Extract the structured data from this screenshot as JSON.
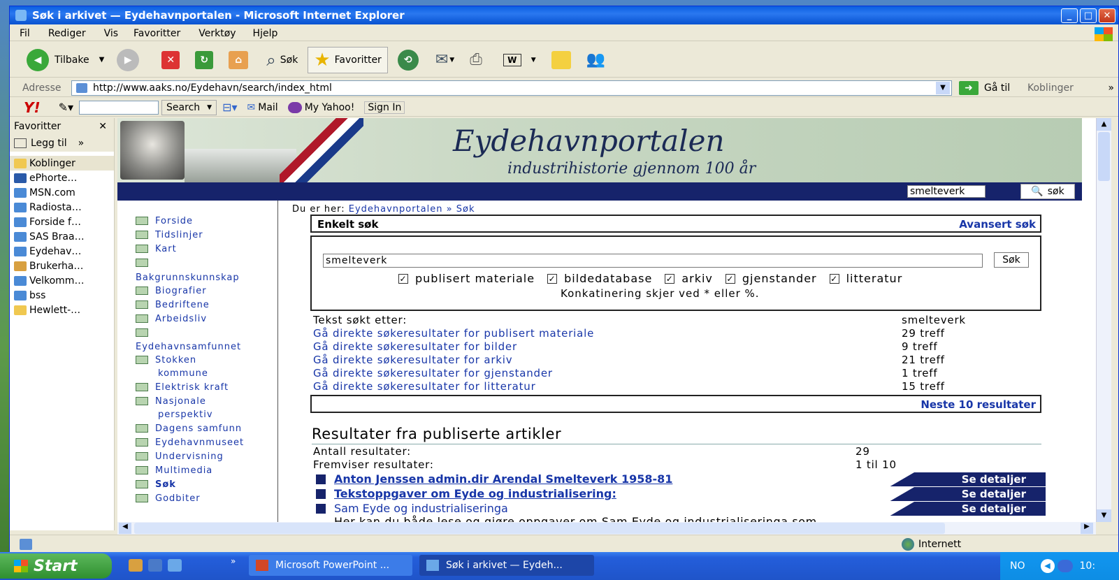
{
  "window": {
    "title": "Søk i arkivet — Eydehavnportalen - Microsoft Internet Explorer",
    "min": "_",
    "max": "□",
    "close": "✕"
  },
  "menu": [
    "Fil",
    "Rediger",
    "Vis",
    "Favoritter",
    "Verktøy",
    "Hjelp"
  ],
  "toolbar": {
    "back": "Tilbake",
    "search": "Søk",
    "favorites": "Favoritter"
  },
  "address": {
    "label": "Adresse",
    "url": "http://www.aaks.no/Eydehavn/search/index_html",
    "go": "Gå til",
    "links": "Koblinger"
  },
  "yahoo": {
    "logo": "Y!",
    "search": "Search",
    "mail": "Mail",
    "myyahoo": "My Yahoo!",
    "signin": "Sign In"
  },
  "favorites": {
    "title": "Favoritter",
    "add": "Legg til",
    "items": [
      "Koblinger",
      "ePhorte…",
      "MSN.com",
      "Radiosta…",
      "Forside f…",
      "SAS Braa…",
      "Eydehav…",
      "Brukerha…",
      "Velkomm…",
      "bss",
      "Hewlett-…"
    ]
  },
  "site": {
    "title": "Eydehavnportalen",
    "tagline": "industrihistorie gjennom 100 år",
    "search_value": "smelteverk",
    "search_btn": "søk"
  },
  "nav": {
    "items": [
      "Forside",
      "Tidslinjer",
      "Kart"
    ],
    "sec1": "Bakgrunnskunnskap",
    "items2": [
      "Biografier",
      "Bedriftene",
      "Arbeidsliv"
    ],
    "sec2": "Eydehavnsamfunnet",
    "items3a": "Stokken",
    "items3b": "kommune",
    "items3c": "Elektrisk kraft",
    "items3d": "Nasjonale",
    "items3e": "perspektiv",
    "items4": [
      "Dagens samfunn",
      "Eydehavnmuseet",
      "Undervisning",
      "Multimedia",
      "Søk",
      "Godbiter"
    ]
  },
  "breadcrumb": {
    "prefix": "Du er her:",
    "home": "Eydehavnportalen",
    "sep": "»",
    "current": "Søk"
  },
  "simple": {
    "title": "Enkelt søk",
    "advanced": "Avansert søk",
    "query": "smelteverk",
    "button": "Søk",
    "checks": [
      "publisert materiale",
      "bildedatabase",
      "arkiv",
      "gjenstander",
      "litteratur"
    ],
    "note": "Konkatinering skjer ved * eller %."
  },
  "summary": {
    "label": "Tekst søkt etter:",
    "value": "smelteverk",
    "rows": [
      {
        "link": "Gå direkte søkeresultater for publisert materiale",
        "count": "29 treff"
      },
      {
        "link": "Gå direkte søkeresultater for bilder",
        "count": "9 treff"
      },
      {
        "link": "Gå direkte søkeresultater for arkiv",
        "count": "21 treff"
      },
      {
        "link": "Gå direkte søkeresultater for gjenstander",
        "count": "1 treff"
      },
      {
        "link": "Gå direkte søkeresultater for litteratur",
        "count": "15 treff"
      }
    ],
    "next": "Neste 10 resultater"
  },
  "results": {
    "heading": "Resultater fra publiserte artikler",
    "count_label": "Antall resultater:",
    "count": "29",
    "showing_label": "Fremviser resultater:",
    "showing": "1 til 10",
    "details": "Se detaljer",
    "items": [
      "Anton Jenssen admin.dir Arendal Smelteverk 1958-81",
      "Tekstoppgaver om Eyde og industrialisering:",
      "Sam Eyde og industrialiseringa"
    ],
    "snippet": "Her kan du både lese og gjøre oppgaver om Sam Eyde og industrialiseringa som"
  },
  "status": {
    "zone": "Internett"
  },
  "taskbar": {
    "start": "Start",
    "tasks": [
      "Microsoft PowerPoint ...",
      "Søk i arkivet — Eydeh..."
    ],
    "lang": "NO",
    "clock": "10:"
  }
}
